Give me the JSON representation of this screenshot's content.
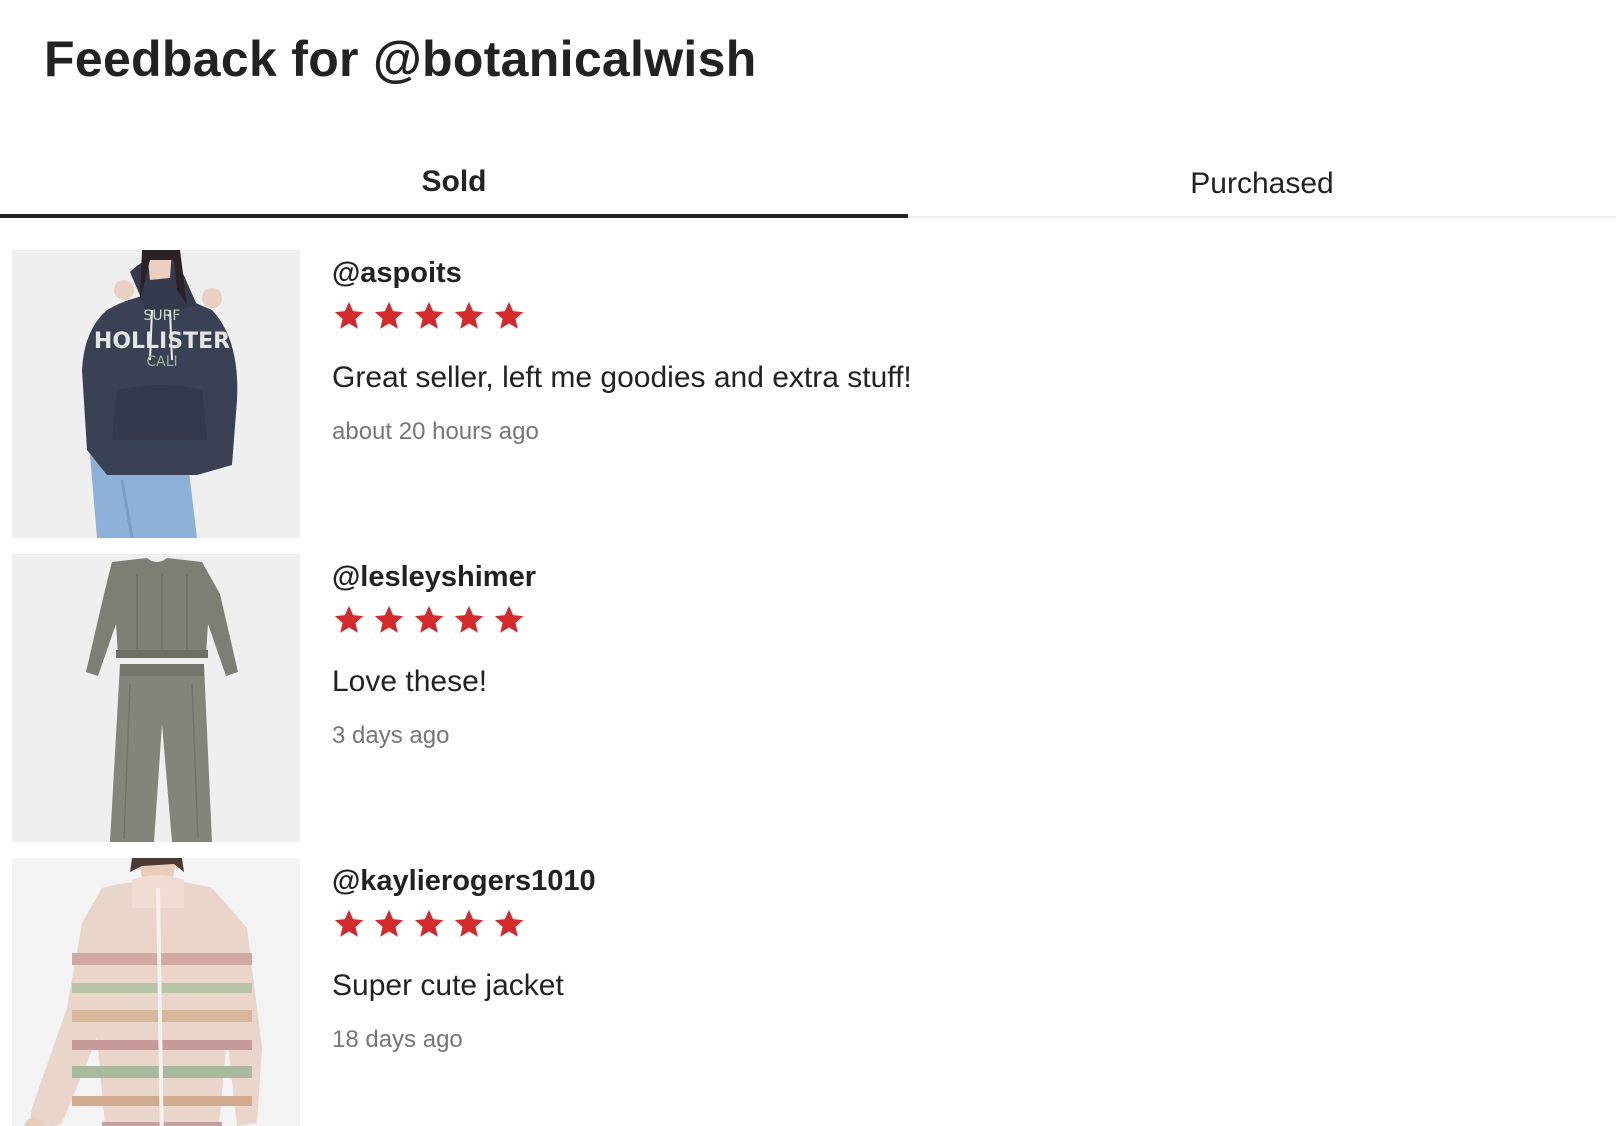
{
  "title": "Feedback for @botanicalwish",
  "tabs": [
    {
      "label": "Sold",
      "active": true
    },
    {
      "label": "Purchased",
      "active": false
    }
  ],
  "colors": {
    "star": "#d42a2e",
    "text": "#222222",
    "muted": "#767676",
    "divider": "#eeeeee"
  },
  "reviews": [
    {
      "username": "@aspoits",
      "rating": 5,
      "comment": "Great seller, left me goodies and extra stuff!",
      "time": "about 20 hours ago",
      "image": "navy-hollister-hoodie",
      "image_text": [
        "SURF",
        "HOLLISTER",
        "CALI"
      ]
    },
    {
      "username": "@lesleyshimer",
      "rating": 5,
      "comment": "Love these!",
      "time": "3 days ago",
      "image": "grey-knit-set"
    },
    {
      "username": "@kaylierogers1010",
      "rating": 5,
      "comment": "Super cute jacket",
      "time": "18 days ago",
      "image": "fair-isle-zip-cardigan"
    }
  ]
}
